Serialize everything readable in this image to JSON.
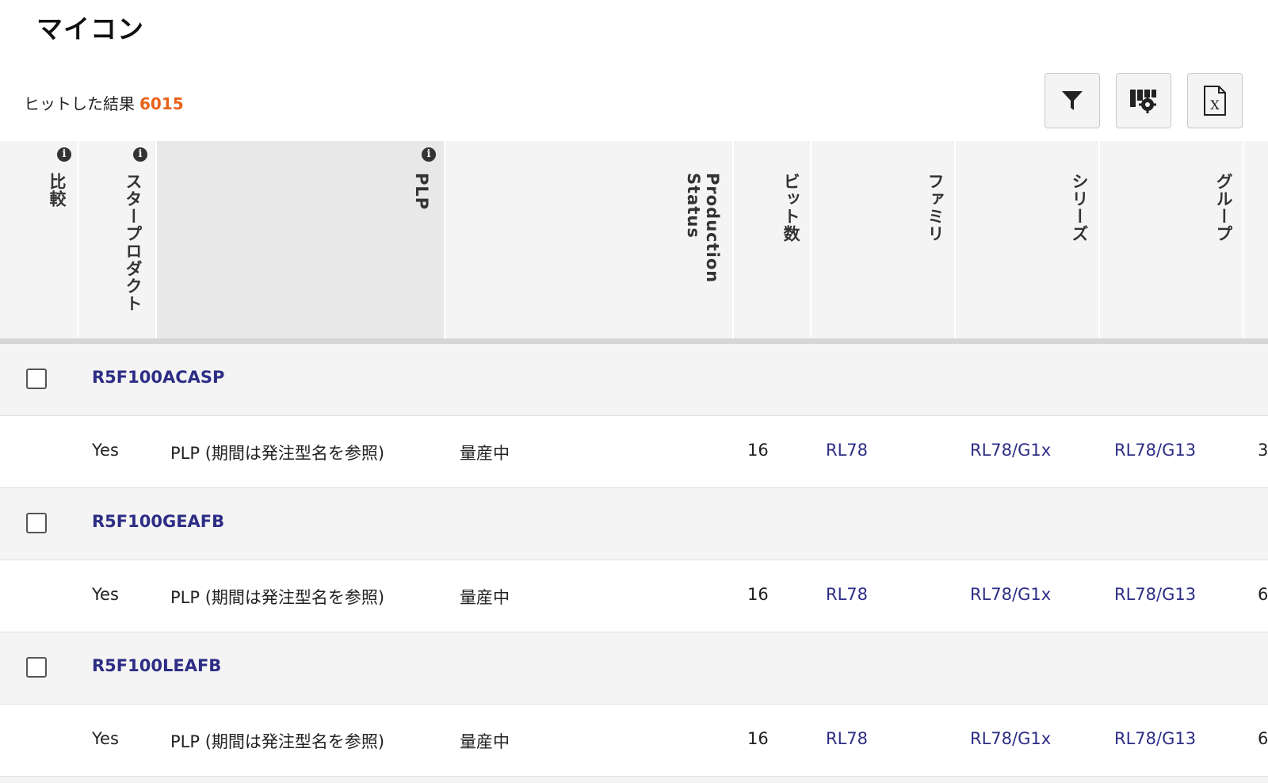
{
  "page_title": "マイコン",
  "results": {
    "label": "ヒットした結果",
    "count": "6015"
  },
  "toolbar": {
    "filter_icon": "filter-icon",
    "column_settings_icon": "column-settings-icon",
    "excel_export_icon": "excel-export-icon"
  },
  "columns": [
    {
      "label": "比較",
      "info": true
    },
    {
      "label": "スタープロダクト",
      "info": true
    },
    {
      "label": "PLP",
      "info": true
    },
    {
      "label": "Production\nStatus",
      "info": false
    },
    {
      "label": "ビット数",
      "info": false
    },
    {
      "label": "ファミリ",
      "info": false
    },
    {
      "label": "シリーズ",
      "info": false
    },
    {
      "label": "グループ",
      "info": false
    }
  ],
  "rows": [
    {
      "part": "R5F100ACASP",
      "star": "Yes",
      "plp": "PLP (期間は発注型名を参照)",
      "status": "量産中",
      "bits": "16",
      "family": "RL78",
      "series": "RL78/G1x",
      "group": "RL78/G13",
      "next": "3"
    },
    {
      "part": "R5F100GEAFB",
      "star": "Yes",
      "plp": "PLP (期間は発注型名を参照)",
      "status": "量産中",
      "bits": "16",
      "family": "RL78",
      "series": "RL78/G1x",
      "group": "RL78/G13",
      "next": "6"
    },
    {
      "part": "R5F100LEAFB",
      "star": "Yes",
      "plp": "PLP (期間は発注型名を参照)",
      "status": "量産中",
      "bits": "16",
      "family": "RL78",
      "series": "RL78/G1x",
      "group": "RL78/G13",
      "next": "6"
    }
  ],
  "colors": {
    "accent_count": "#e8631a",
    "link": "#2d2d86"
  }
}
